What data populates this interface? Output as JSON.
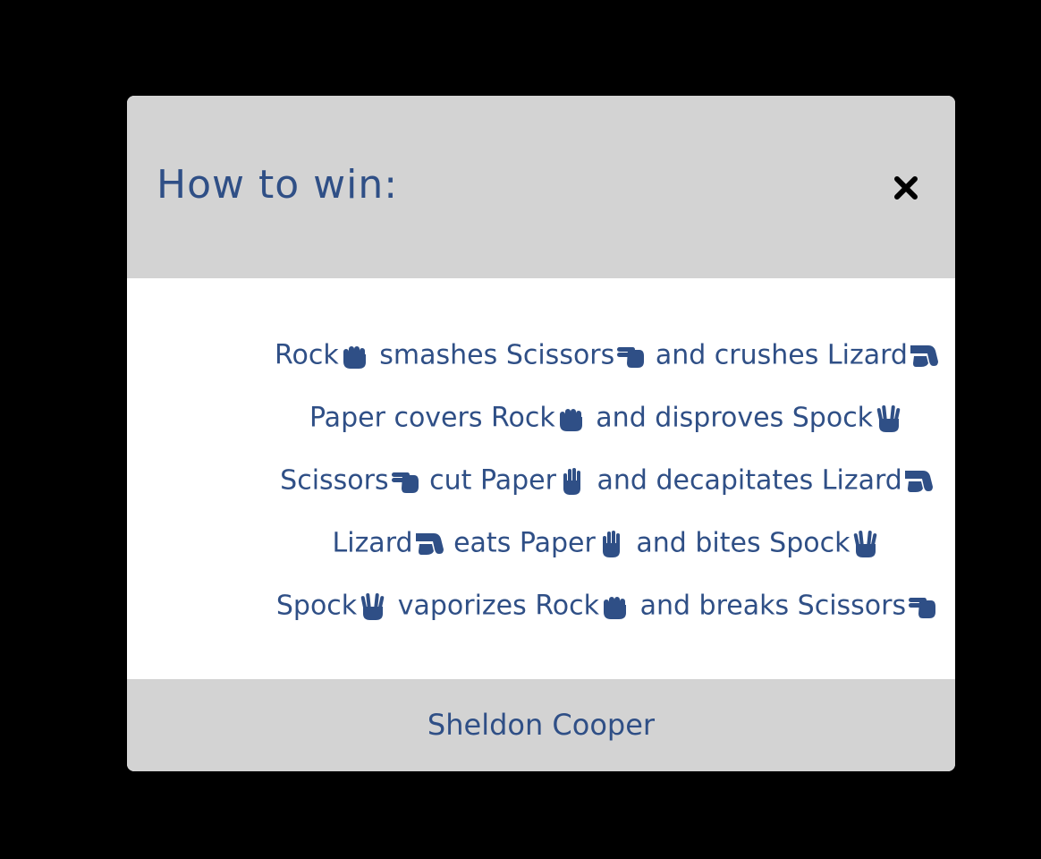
{
  "modal": {
    "title": "How to win:",
    "close_icon": "close-x-icon",
    "footer_credit": "Sheldon Cooper"
  },
  "colors": {
    "text": "#2f4f86",
    "header_bg": "#d3d3d3",
    "body_bg": "#ffffff",
    "backdrop": "#000000"
  },
  "rules": [
    {
      "subject": "Rock",
      "subject_icon": "rock-hand-icon",
      "verb1": "smashes",
      "object1": "Scissors",
      "object1_icon": "scissors-hand-icon",
      "verb2": "and crushes",
      "object2": "Lizard",
      "object2_icon": "lizard-hand-icon"
    },
    {
      "subject": "Paper",
      "subject_icon": "",
      "verb1": "covers",
      "object1": "Rock",
      "object1_icon": "rock-hand-icon",
      "verb2": "and disproves",
      "object2": "Spock",
      "object2_icon": "spock-hand-icon"
    },
    {
      "subject": "Scissors",
      "subject_icon": "scissors-hand-icon",
      "verb1": "cut",
      "object1": "Paper",
      "object1_icon": "paper-hand-icon",
      "verb2": "and decapitates",
      "object2": "Lizard",
      "object2_icon": "lizard-hand-icon"
    },
    {
      "subject": "Lizard",
      "subject_icon": "lizard-hand-icon",
      "verb1": "eats",
      "object1": "Paper",
      "object1_icon": "paper-hand-icon",
      "verb2": "and bites",
      "object2": "Spock",
      "object2_icon": "spock-hand-icon"
    },
    {
      "subject": "Spock",
      "subject_icon": "spock-hand-icon",
      "verb1": "vaporizes",
      "object1": "Rock",
      "object1_icon": "rock-hand-icon",
      "verb2": "and breaks",
      "object2": "Scissors",
      "object2_icon": "scissors-hand-icon"
    }
  ]
}
